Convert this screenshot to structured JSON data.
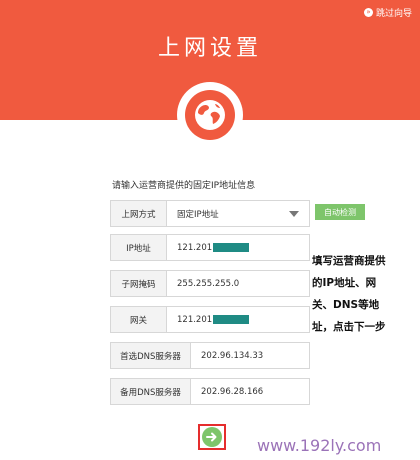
{
  "header": {
    "skip_label": "跳过向导",
    "title": "上网设置"
  },
  "form": {
    "instruction": "请输入运营商提供的固定IP地址信息",
    "connection_type": {
      "label": "上网方式",
      "value": "固定IP地址"
    },
    "auto_detect_label": "自动检测",
    "ip": {
      "label": "IP地址",
      "value": "121.201"
    },
    "subnet": {
      "label": "子网掩码",
      "value": "255.255.255.0"
    },
    "gateway": {
      "label": "网关",
      "value": "121.201"
    },
    "dns_primary": {
      "label": "首选DNS服务器",
      "value": "202.96.134.33"
    },
    "dns_secondary": {
      "label": "备用DNS服务器",
      "value": "202.96.28.166"
    }
  },
  "annotation": {
    "lines": [
      "填写运营商提供",
      "的IP地址、网",
      "关、DNS等地",
      "址，点击下一步"
    ]
  },
  "watermark": "www.192ly.com",
  "colors": {
    "header": "#f05a3f",
    "button_green": "#7ec56b",
    "highlight_red": "#e52d2d"
  },
  "icons": {
    "globe": "globe-icon",
    "next": "arrow-right-icon",
    "skip": "skip-icon"
  }
}
